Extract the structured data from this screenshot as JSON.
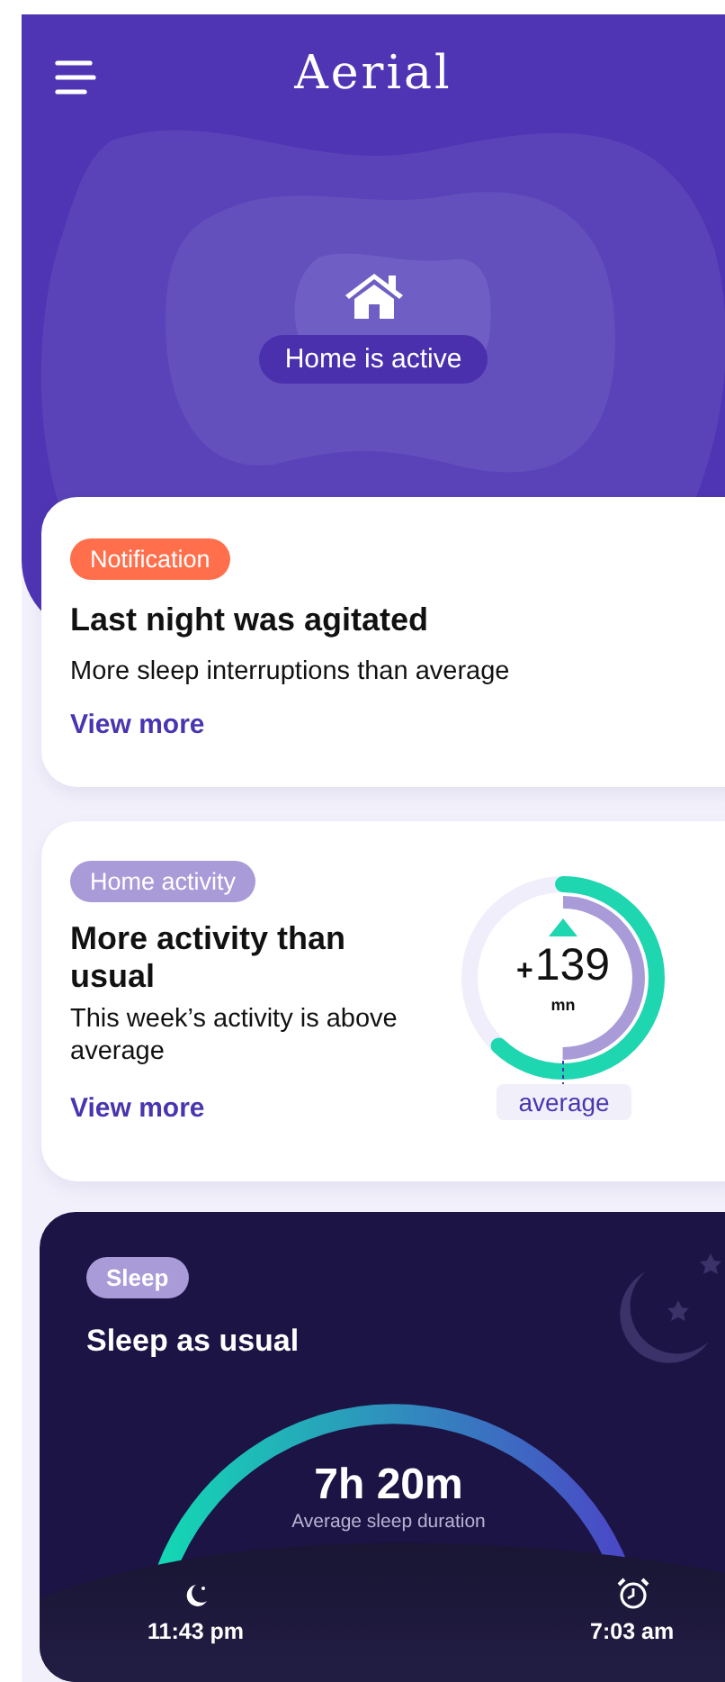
{
  "header": {
    "logo": "Aerial",
    "status": "Home is active"
  },
  "notification_card": {
    "badge": "Notification",
    "title": "Last night was agitated",
    "text": "More sleep interruptions than average",
    "link": "View more"
  },
  "activity_card": {
    "badge": "Home activity",
    "title": "More activity than usual",
    "text": "This week’s activity is above average",
    "link": "View more",
    "sign": "+",
    "value": "139",
    "unit": "mn",
    "reference": "average",
    "meter": {
      "level": 0.62
    },
    "average_marker": {
      "level": 0.5
    }
  },
  "sleep_card": {
    "badge": "Sleep",
    "title": "Sleep as usual",
    "duration": "7h 20m",
    "duration_label": "Average sleep duration",
    "bedtime": "11:43 pm",
    "wake_time": "7:03 am"
  }
}
